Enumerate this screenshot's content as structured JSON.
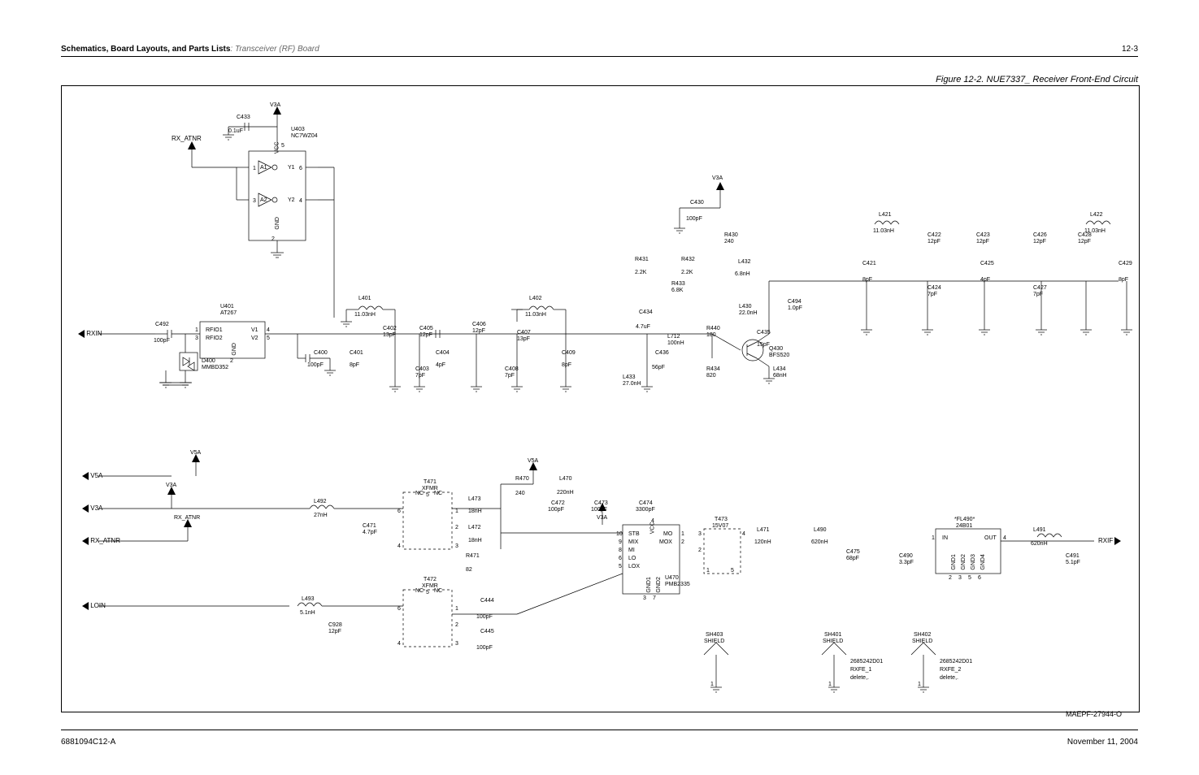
{
  "header": {
    "bold": "Schematics, Board Layouts, and Parts Lists",
    "light": ": Transceiver (RF) Board",
    "page": "12-3"
  },
  "figure_title": "Figure 12-2. NUE7337_ Receiver Front-End Circuit",
  "footer": {
    "left": "6881094C12-A",
    "right": "November 11, 2004"
  },
  "maepf": "MAEPF-27944-O",
  "ports": {
    "rx_atnr_top": "RX_ATNR",
    "rxin": "RXIN",
    "v5a": "V5A",
    "v3a": "V3A",
    "rx_atnr_bot": "RX_ATNR",
    "loin": "LOIN",
    "rxif": "RXIF"
  },
  "rails": {
    "v3a_top": "V3A",
    "v5a_mid": "V5A",
    "v3a_mid": "V3A",
    "v5a_right": "V5A",
    "v3a_right": "V3A",
    "v3a_rf": "V3A"
  },
  "ics": {
    "u403": {
      "ref": "U403",
      "part": "NC7WZ04",
      "pins": {
        "a1": "A1",
        "y1": "Y1",
        "a2": "A2",
        "y2": "Y2",
        "vcc": "VCC",
        "gnd": "GND",
        "p1": "1",
        "p2": "2",
        "p3": "3",
        "p4": "4",
        "p5": "5",
        "p6": "6"
      }
    },
    "u401": {
      "ref": "U401",
      "part": "AT267",
      "pins": {
        "rfio1": "RFIO1",
        "rfio2": "RFIO2",
        "v1": "V1",
        "v2": "V2",
        "gnd": "GND",
        "p1": "1",
        "p2": "2",
        "p3": "3",
        "p4": "4",
        "p5": "5"
      }
    },
    "u470": {
      "ref": "U470",
      "part": "PMB2335",
      "pins": {
        "stb": "STB",
        "mix": "MIX",
        "mi": "MI",
        "lo": "LO",
        "lox": "LOX",
        "vcc": "VCC",
        "mo": "MO",
        "mox": "MOX",
        "gnd1": "GND1",
        "gnd2": "GND2",
        "p1": "1",
        "p2": "2",
        "p3": "3",
        "p4": "4",
        "p5": "5",
        "p6": "6",
        "p7": "7",
        "p8": "8",
        "p9": "9",
        "p10": "10"
      }
    },
    "t471": {
      "ref": "T471",
      "part": "XFMR",
      "nc": "NC",
      "p1": "1",
      "p2": "2",
      "p3": "3",
      "p4": "4",
      "p5": "5",
      "p6": "6"
    },
    "t472": {
      "ref": "T472",
      "part": "XFMR",
      "nc": "NC",
      "p1": "1",
      "p2": "2",
      "p3": "3",
      "p4": "4",
      "p5": "5",
      "p6": "6"
    },
    "t473": {
      "ref": "T473",
      "part": "15V07",
      "p1": "1",
      "p2": "2",
      "p3": "3",
      "p4": "4",
      "p5": "5"
    },
    "fl490": {
      "ref": "*FL490*",
      "part": "24B01",
      "in": "IN",
      "out": "OUT",
      "gnd1": "GND1",
      "gnd2": "GND2",
      "gnd3": "GND3",
      "gnd4": "GND4",
      "p1": "1",
      "p2": "2",
      "p3": "3",
      "p4": "4",
      "p5": "5",
      "p6": "6"
    },
    "q430": {
      "ref": "Q430",
      "part": "BFS520"
    }
  },
  "shields": {
    "sh403": {
      "ref": "SH403",
      "label": "SHIELD"
    },
    "sh401": {
      "ref": "SH401",
      "label": "SHIELD",
      "pn": "2685242D01",
      "name": "RXFE_1",
      "del": "delete,."
    },
    "sh402": {
      "ref": "SH402",
      "label": "SHIELD",
      "pn": "2685242D01",
      "name": "RXFE_2",
      "del": "delete,."
    }
  },
  "components": {
    "c433": {
      "ref": "C433",
      "val": "0.1uF"
    },
    "c492": {
      "ref": "C492",
      "val": "100pF"
    },
    "d400": {
      "ref": "D400",
      "val": "MMBD352"
    },
    "c400": {
      "ref": "C400",
      "val": "100pF"
    },
    "l401": {
      "ref": "L401",
      "val": "11.03nH"
    },
    "c401": {
      "ref": "C401",
      "val": "8pF"
    },
    "c402": {
      "ref": "C402",
      "val": "13pF"
    },
    "c403": {
      "ref": "C403",
      "val": "7pF"
    },
    "c404": {
      "ref": "C404",
      "val": "4pF"
    },
    "c405": {
      "ref": "C405",
      "val": "12pF"
    },
    "c406": {
      "ref": "C406",
      "val": "12pF"
    },
    "c407": {
      "ref": "C407",
      "val": "13pF"
    },
    "c408": {
      "ref": "C408",
      "val": "7pF"
    },
    "c409": {
      "ref": "C409",
      "val": "8pF"
    },
    "l402": {
      "ref": "L402",
      "val": "11.03nH"
    },
    "c430": {
      "ref": "C430",
      "val": "100pF"
    },
    "r430": {
      "ref": "R430",
      "val": "240"
    },
    "r431": {
      "ref": "R431",
      "val": "2.2K"
    },
    "r432": {
      "ref": "R432",
      "val": "2.2K"
    },
    "r433": {
      "ref": "R433",
      "val": "6.8K"
    },
    "r434": {
      "ref": "R434",
      "val": "820"
    },
    "r440": {
      "ref": "R440",
      "val": "180"
    },
    "c434": {
      "ref": "C434",
      "val": "4.7uF"
    },
    "c435": {
      "ref": "C435",
      "val": "15pF"
    },
    "c436": {
      "ref": "C436",
      "val": "56pF"
    },
    "l430": {
      "ref": "L430",
      "val": "22.0nH"
    },
    "l432": {
      "ref": "L432",
      "val": "6.8nH"
    },
    "l433": {
      "ref": "L433",
      "val": "27.0nH"
    },
    "l434": {
      "ref": "L434",
      "val": "68nH"
    },
    "l712": {
      "ref": "L712",
      "val": "100nH"
    },
    "c494": {
      "ref": "C494",
      "val": "1.0pF"
    },
    "l421": {
      "ref": "L421",
      "val": "11.03nH"
    },
    "c421": {
      "ref": "C421",
      "val": "8pF"
    },
    "c422": {
      "ref": "C422",
      "val": "12pF"
    },
    "c423": {
      "ref": "C423",
      "val": "12pF"
    },
    "c424": {
      "ref": "C424",
      "val": "7pF"
    },
    "c425": {
      "ref": "C425",
      "val": "4pF"
    },
    "c426": {
      "ref": "C426",
      "val": "12pF"
    },
    "c427": {
      "ref": "C427",
      "val": "7pF"
    },
    "c428": {
      "ref": "C428",
      "val": "12pF"
    },
    "c429": {
      "ref": "C429",
      "val": "8pF"
    },
    "l422": {
      "ref": "L422",
      "val": "11.03nH"
    },
    "l492": {
      "ref": "L492",
      "val": "27nH"
    },
    "c471": {
      "ref": "C471",
      "val": "4.7pF"
    },
    "l473": {
      "ref": "L473",
      "val": "18nH"
    },
    "l472": {
      "ref": "L472",
      "val": "18nH"
    },
    "r470": {
      "ref": "R470",
      "val": "240"
    },
    "r471": {
      "ref": "R471",
      "val": "82"
    },
    "l470": {
      "ref": "L470",
      "val": "220nH"
    },
    "c472": {
      "ref": "C472",
      "val": "100pF"
    },
    "c473": {
      "ref": "C473",
      "val": "100pF"
    },
    "c474": {
      "ref": "C474",
      "val": "3300pF"
    },
    "l493": {
      "ref": "L493",
      "val": "5.1nH"
    },
    "c928": {
      "ref": "C928",
      "val": "12pF"
    },
    "c444": {
      "ref": "C444",
      "val": "100pF"
    },
    "c445": {
      "ref": "C445",
      "val": "100pF"
    },
    "l471": {
      "ref": "L471",
      "val": "120nH"
    },
    "l490": {
      "ref": "L490",
      "val": "620nH"
    },
    "c475": {
      "ref": "C475",
      "val": "68pF"
    },
    "c490": {
      "ref": "C490",
      "val": "3.3pF"
    },
    "l491": {
      "ref": "L491",
      "val": "620nH"
    },
    "c491": {
      "ref": "C491",
      "val": "5.1pF"
    }
  },
  "pins": {
    "one": "1"
  }
}
